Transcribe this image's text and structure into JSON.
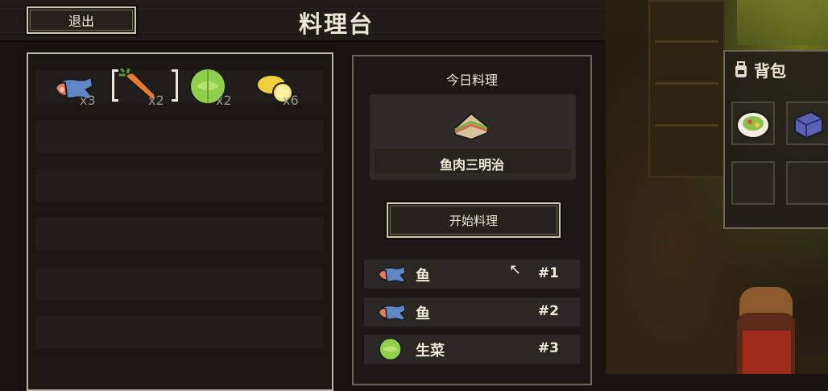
{
  "header": {
    "exit_label": "退出",
    "title": "料理台"
  },
  "ingredients": [
    {
      "name": "fish",
      "icon": "fish-icon",
      "count": "x3",
      "selected": false
    },
    {
      "name": "carrot",
      "icon": "carrot-icon",
      "count": "x2",
      "selected": true
    },
    {
      "name": "cabbage",
      "icon": "cabbage-icon",
      "count": "x2",
      "selected": false
    },
    {
      "name": "lemon",
      "icon": "lemon-icon",
      "count": "x6",
      "selected": false
    }
  ],
  "recipe": {
    "heading": "今日料理",
    "dish_icon": "sandwich-icon",
    "dish_name": "鱼肉三明治",
    "start_label": "开始料理",
    "slots": [
      {
        "name": "鱼",
        "icon": "fish-icon",
        "number": "#1"
      },
      {
        "name": "鱼",
        "icon": "fish-icon",
        "number": "#2"
      },
      {
        "name": "生菜",
        "icon": "cabbage-icon",
        "number": "#3"
      }
    ]
  },
  "backpack": {
    "title": "背包",
    "items": [
      {
        "icon": "salad-plate-icon"
      },
      {
        "icon": "box-icon"
      }
    ]
  }
}
